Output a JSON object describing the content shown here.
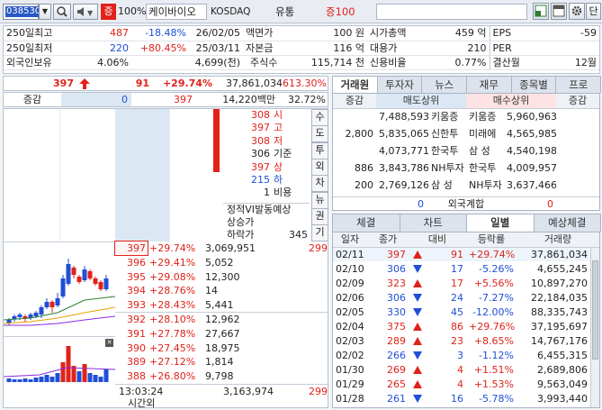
{
  "toolbar": {
    "code": "038530",
    "market_badge": "증",
    "pct": "100%",
    "name": "케이바이오",
    "market": "KOSDAQ",
    "type": "유통",
    "margin": "증100",
    "side_btn": "단"
  },
  "info": [
    [
      "250일최고",
      "487",
      "-18.48%",
      "26/02/05",
      "액면가",
      "100 원",
      "시가총액",
      "459 억",
      "EPS",
      "-59"
    ],
    [
      "250일최저",
      "220",
      "+80.45%",
      "25/03/11",
      "자본금",
      "116 억",
      "대용가",
      "210",
      "PER",
      ""
    ],
    [
      "외국인보유",
      "4.06%",
      "",
      "4,699(천)",
      "주식수",
      "115,714 천",
      "신용비율",
      "0.77%",
      "결산월",
      "12월"
    ]
  ],
  "quote": {
    "price": "397",
    "change": "91",
    "rate": "+29.74%",
    "volume": "37,861,034",
    "vol_rate": "613.30%"
  },
  "diff": {
    "label": "증감",
    "v1": "0",
    "v2": "397",
    "amount": "14,220백만",
    "ratio": "32.72%"
  },
  "pricebox": [
    {
      "v": "308",
      "l": "시",
      "c": "red"
    },
    {
      "v": "397",
      "l": "고",
      "c": "red"
    },
    {
      "v": "308",
      "l": "저",
      "c": "red"
    },
    {
      "v": "306",
      "l": "기준",
      "c": "dark"
    },
    {
      "v": "397",
      "l": "상",
      "c": "red"
    },
    {
      "v": "215",
      "l": "하",
      "c": "blue"
    },
    {
      "v": "1",
      "l": "비용",
      "c": "dark"
    }
  ],
  "vi": {
    "title": "정적VI발동예상",
    "up": "상승가",
    "down": "하락가",
    "down_v": "345"
  },
  "side_tabs": [
    "수",
    "도",
    "투",
    "외",
    "차",
    "뉴",
    "권",
    "기"
  ],
  "orderbook": [
    {
      "price": "397",
      "rate": "+29.74%",
      "vol": "3,069,951",
      "extra": "299",
      "sel": true
    },
    {
      "price": "396",
      "rate": "+29.41%",
      "vol": "5,052"
    },
    {
      "price": "395",
      "rate": "+29.08%",
      "vol": "12,300"
    },
    {
      "price": "394",
      "rate": "+28.76%",
      "vol": "14"
    },
    {
      "price": "393",
      "rate": "+28.43%",
      "vol": "5,441"
    },
    {
      "price": "392",
      "rate": "+28.10%",
      "vol": "12,962"
    },
    {
      "price": "391",
      "rate": "+27.78%",
      "vol": "27,667"
    },
    {
      "price": "390",
      "rate": "+27.45%",
      "vol": "18,975"
    },
    {
      "price": "389",
      "rate": "+27.12%",
      "vol": "1,814"
    },
    {
      "price": "388",
      "rate": "+26.80%",
      "vol": "9,798"
    }
  ],
  "ob_footer": {
    "time": "13:03:24",
    "total": "3,163,974",
    "extra": "299",
    "after": "시간외"
  },
  "broker_tabs": [
    "거래원",
    "투자자",
    "뉴스",
    "재무",
    "종목별",
    "프로"
  ],
  "broker_head": [
    "증감",
    "매도상위",
    "매수상위",
    "증감"
  ],
  "brokers": [
    {
      "sd": "",
      "sv": "7,488,593",
      "sn": "키움증",
      "bn": "키움증",
      "bv": "5,960,963",
      "bd": ""
    },
    {
      "sd": "2,800",
      "sv": "5,835,065",
      "sn": "신한투",
      "bn": "미래에",
      "bv": "4,565,985",
      "bd": ""
    },
    {
      "sd": "",
      "sv": "4,073,771",
      "sn": "한국투",
      "bn": "삼 성",
      "bv": "4,540,198",
      "bd": ""
    },
    {
      "sd": "886",
      "sv": "3,843,786",
      "sn": "NH투자",
      "bn": "한국투",
      "bv": "4,009,957",
      "bd": ""
    },
    {
      "sd": "200",
      "sv": "2,769,126",
      "sn": "삼 성",
      "bn": "NH투자",
      "bv": "3,637,466",
      "bd": ""
    }
  ],
  "foreign": {
    "l": "0",
    "label": "외국계합",
    "r": "0"
  },
  "daily_tabs": [
    "체결",
    "차트",
    "일별",
    "예상체결"
  ],
  "daily_head": [
    "일자",
    "종가",
    "대비",
    "등락률",
    "거래량"
  ],
  "daily": [
    {
      "d": "02/11",
      "p": "397",
      "dir": "up",
      "ch": "91",
      "r": "+29.74%",
      "v": "37,861,034",
      "sel": true
    },
    {
      "d": "02/10",
      "p": "306",
      "dir": "dn",
      "ch": "17",
      "r": "-5.26%",
      "v": "4,655,245"
    },
    {
      "d": "02/09",
      "p": "323",
      "dir": "up",
      "ch": "17",
      "r": "+5.56%",
      "v": "10,897,270"
    },
    {
      "d": "02/06",
      "p": "306",
      "dir": "dn",
      "ch": "24",
      "r": "-7.27%",
      "v": "22,184,035"
    },
    {
      "d": "02/05",
      "p": "330",
      "dir": "dn",
      "ch": "45",
      "r": "-12.00%",
      "v": "88,335,743"
    },
    {
      "d": "02/04",
      "p": "375",
      "dir": "up",
      "ch": "86",
      "r": "+29.76%",
      "v": "37,195,697"
    },
    {
      "d": "02/03",
      "p": "289",
      "dir": "up",
      "ch": "23",
      "r": "+8.65%",
      "v": "14,767,176"
    },
    {
      "d": "02/02",
      "p": "266",
      "dir": "dn",
      "ch": "3",
      "r": "-1.12%",
      "v": "6,455,315"
    },
    {
      "d": "01/30",
      "p": "269",
      "dir": "up",
      "ch": "4",
      "r": "+1.51%",
      "v": "2,689,806"
    },
    {
      "d": "01/29",
      "p": "265",
      "dir": "up",
      "ch": "4",
      "r": "+1.53%",
      "v": "9,563,049"
    },
    {
      "d": "01/28",
      "p": "261",
      "dir": "dn",
      "ch": "16",
      "r": "-5.78%",
      "v": "3,993,440"
    }
  ]
}
